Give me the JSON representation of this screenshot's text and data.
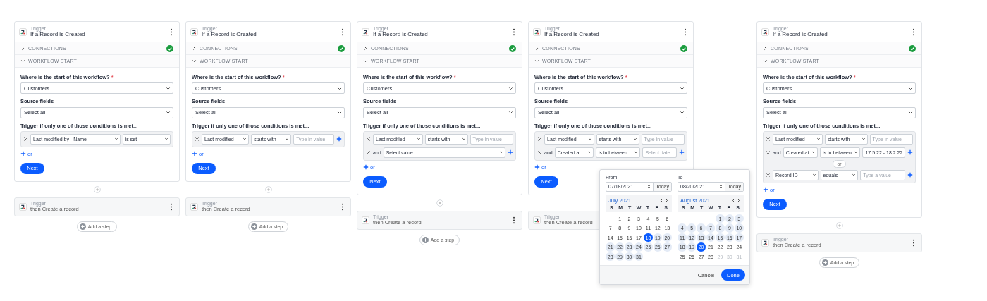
{
  "panels": [
    {
      "trigger_label": "Trigger",
      "title": "If a Record is Created",
      "connections": {
        "label": "CONNECTIONS",
        "expanded": false,
        "complete": true
      },
      "workflow_start": {
        "label": "WORKFLOW START",
        "expanded": true
      },
      "start_question": {
        "label": "Where is the start of this workflow?",
        "required_mark": "*",
        "value": "Customers"
      },
      "source_fields": {
        "label": "Source fields",
        "value": "Select all"
      },
      "conditions_label": "Trigger if only one of those conditions is met...",
      "condition_groups": [
        {
          "rows": [
            {
              "cells": [
                {
                  "kind": "select",
                  "value": "Last modified by - Name"
                },
                {
                  "kind": "select",
                  "value": "is set"
                }
              ],
              "add": false
            }
          ]
        }
      ],
      "add_or": "or",
      "next": "Next",
      "step": {
        "label": "Trigger",
        "title": "then Create a record"
      },
      "add_step": "Add a step"
    },
    {
      "trigger_label": "Trigger",
      "title": "If a Record is Created",
      "connections": {
        "label": "CONNECTIONS",
        "expanded": false,
        "complete": true
      },
      "workflow_start": {
        "label": "WORKFLOW START",
        "expanded": true
      },
      "start_question": {
        "label": "Where is the start of this workflow?",
        "required_mark": "*",
        "value": "Customers"
      },
      "source_fields": {
        "label": "Source fields",
        "value": "Select all"
      },
      "conditions_label": "Trigger if only one of those conditions is met...",
      "condition_groups": [
        {
          "rows": [
            {
              "cells": [
                {
                  "kind": "select",
                  "value": "Last modified"
                },
                {
                  "kind": "select",
                  "value": "starts with"
                },
                {
                  "kind": "input",
                  "placeholder": "Type in value"
                }
              ],
              "add": true
            }
          ]
        }
      ],
      "add_or": "or",
      "next": "Next",
      "step": {
        "label": "Trigger",
        "title": "then Create a record"
      },
      "add_step": "Add a step"
    },
    {
      "trigger_label": "Trigger",
      "title": "If a Record is Created",
      "connections": {
        "label": "CONNECTIONS",
        "expanded": false,
        "complete": true
      },
      "workflow_start": {
        "label": "WORKFLOW START",
        "expanded": true
      },
      "start_question": {
        "label": "Where is the start of this workflow?",
        "required_mark": "*",
        "value": "Customers"
      },
      "source_fields": {
        "label": "Source fields",
        "value": "Select all"
      },
      "conditions_label": "Trigger if only one of those conditions is met...",
      "condition_groups": [
        {
          "rows": [
            {
              "cells": [
                {
                  "kind": "select",
                  "value": "Last modified"
                },
                {
                  "kind": "select",
                  "value": "starts with"
                },
                {
                  "kind": "input",
                  "placeholder": "Type in value"
                }
              ],
              "add": false
            },
            {
              "conjunction": "and",
              "cells": [
                {
                  "kind": "select",
                  "value": "Select value"
                }
              ],
              "add": true
            }
          ]
        }
      ],
      "add_or": "or",
      "next": "Next",
      "step": {
        "label": "Trigger",
        "title": "then Create a record"
      },
      "add_step": "Add a step"
    },
    {
      "trigger_label": "Trigger",
      "title": "If a Record is Created",
      "connections": {
        "label": "CONNECTIONS",
        "expanded": false,
        "complete": true
      },
      "workflow_start": {
        "label": "WORKFLOW START",
        "expanded": true
      },
      "start_question": {
        "label": "Where is the start of this workflow?",
        "required_mark": "*",
        "value": "Customers"
      },
      "source_fields": {
        "label": "Source fields",
        "value": "Select all"
      },
      "conditions_label": "Trigger if only one of those conditions is met...",
      "condition_groups": [
        {
          "rows": [
            {
              "cells": [
                {
                  "kind": "select",
                  "value": "Last modified"
                },
                {
                  "kind": "select",
                  "value": "starts with"
                },
                {
                  "kind": "input",
                  "placeholder": "Type in value"
                }
              ],
              "add": false
            },
            {
              "conjunction": "and",
              "cells": [
                {
                  "kind": "select",
                  "value": "Created at"
                },
                {
                  "kind": "select",
                  "value": "is in between"
                },
                {
                  "kind": "input",
                  "placeholder": "Select date"
                }
              ],
              "add": true
            }
          ]
        }
      ],
      "add_or": "or",
      "next": "Next",
      "step": {
        "label": "Trigger",
        "title": "then Create a record"
      },
      "date_picker": {
        "fields": [
          {
            "label": "From",
            "value": "07/18/2021",
            "today": "Today"
          },
          {
            "label": "To",
            "value": "08/20/2021",
            "today": "Today"
          }
        ],
        "calendars": [
          {
            "month": "July 2021",
            "weekdays": [
              "S",
              "M",
              "T",
              "W",
              "T",
              "F",
              "S"
            ],
            "days": [
              {
                "kind": "blank"
              },
              {
                "kind": "day",
                "day": "1",
                "selected": false,
                "in_range": false,
                "disabled": false
              },
              {
                "kind": "day",
                "day": "2",
                "selected": false,
                "in_range": false,
                "disabled": false
              },
              {
                "kind": "day",
                "day": "3",
                "selected": false,
                "in_range": false,
                "disabled": false
              },
              {
                "kind": "day",
                "day": "4",
                "selected": false,
                "in_range": false,
                "disabled": false
              },
              {
                "kind": "day",
                "day": "5",
                "selected": false,
                "in_range": false,
                "disabled": false
              },
              {
                "kind": "day",
                "day": "6",
                "selected": false,
                "in_range": false,
                "disabled": false
              },
              {
                "kind": "day",
                "day": "7",
                "selected": false,
                "in_range": false,
                "disabled": false
              },
              {
                "kind": "day",
                "day": "8",
                "selected": false,
                "in_range": false,
                "disabled": false
              },
              {
                "kind": "day",
                "day": "9",
                "selected": false,
                "in_range": false,
                "disabled": false
              },
              {
                "kind": "day",
                "day": "10",
                "selected": false,
                "in_range": false,
                "disabled": false
              },
              {
                "kind": "day",
                "day": "11",
                "selected": false,
                "in_range": false,
                "disabled": false
              },
              {
                "kind": "day",
                "day": "12",
                "selected": false,
                "in_range": false,
                "disabled": false
              },
              {
                "kind": "day",
                "day": "13",
                "selected": false,
                "in_range": false,
                "disabled": false
              },
              {
                "kind": "day",
                "day": "14",
                "selected": false,
                "in_range": false,
                "disabled": false
              },
              {
                "kind": "day",
                "day": "15",
                "selected": false,
                "in_range": false,
                "disabled": false
              },
              {
                "kind": "day",
                "day": "16",
                "selected": false,
                "in_range": false,
                "disabled": false
              },
              {
                "kind": "day",
                "day": "17",
                "selected": false,
                "in_range": false,
                "disabled": false
              },
              {
                "kind": "day",
                "day": "18",
                "selected": true,
                "in_range": false,
                "disabled": false
              },
              {
                "kind": "day",
                "day": "19",
                "selected": false,
                "in_range": true,
                "disabled": false
              },
              {
                "kind": "day",
                "day": "20",
                "selected": false,
                "in_range": true,
                "disabled": false
              },
              {
                "kind": "day",
                "day": "21",
                "selected": false,
                "in_range": true,
                "disabled": false
              },
              {
                "kind": "day",
                "day": "22",
                "selected": false,
                "in_range": true,
                "disabled": false
              },
              {
                "kind": "day",
                "day": "23",
                "selected": false,
                "in_range": true,
                "disabled": false
              },
              {
                "kind": "day",
                "day": "24",
                "selected": false,
                "in_range": true,
                "disabled": false
              },
              {
                "kind": "day",
                "day": "25",
                "selected": false,
                "in_range": true,
                "disabled": false
              },
              {
                "kind": "day",
                "day": "26",
                "selected": false,
                "in_range": true,
                "disabled": false
              },
              {
                "kind": "day",
                "day": "27",
                "selected": false,
                "in_range": true,
                "disabled": false
              },
              {
                "kind": "day",
                "day": "28",
                "selected": false,
                "in_range": true,
                "disabled": false
              },
              {
                "kind": "day",
                "day": "29",
                "selected": false,
                "in_range": true,
                "disabled": false
              },
              {
                "kind": "day",
                "day": "30",
                "selected": false,
                "in_range": true,
                "disabled": false
              },
              {
                "kind": "day",
                "day": "31",
                "selected": false,
                "in_range": true,
                "disabled": false
              }
            ]
          },
          {
            "month": "August 2021",
            "weekdays": [
              "S",
              "M",
              "T",
              "W",
              "T",
              "F",
              "S"
            ],
            "days": [
              {
                "kind": "blank"
              },
              {
                "kind": "blank"
              },
              {
                "kind": "blank"
              },
              {
                "kind": "blank"
              },
              {
                "kind": "day",
                "day": "1",
                "selected": false,
                "in_range": true,
                "disabled": false
              },
              {
                "kind": "day",
                "day": "2",
                "selected": false,
                "in_range": true,
                "disabled": false
              },
              {
                "kind": "day",
                "day": "3",
                "selected": false,
                "in_range": true,
                "disabled": false
              },
              {
                "kind": "day",
                "day": "4",
                "selected": false,
                "in_range": true,
                "disabled": false
              },
              {
                "kind": "day",
                "day": "5",
                "selected": false,
                "in_range": true,
                "disabled": false
              },
              {
                "kind": "day",
                "day": "6",
                "selected": false,
                "in_range": true,
                "disabled": false
              },
              {
                "kind": "day",
                "day": "7",
                "selected": false,
                "in_range": true,
                "disabled": false
              },
              {
                "kind": "day",
                "day": "8",
                "selected": false,
                "in_range": true,
                "disabled": false
              },
              {
                "kind": "day",
                "day": "9",
                "selected": false,
                "in_range": true,
                "disabled": false
              },
              {
                "kind": "day",
                "day": "10",
                "selected": false,
                "in_range": true,
                "disabled": false
              },
              {
                "kind": "day",
                "day": "11",
                "selected": false,
                "in_range": true,
                "disabled": false
              },
              {
                "kind": "day",
                "day": "12",
                "selected": false,
                "in_range": true,
                "disabled": false
              },
              {
                "kind": "day",
                "day": "13",
                "selected": false,
                "in_range": true,
                "disabled": false
              },
              {
                "kind": "day",
                "day": "14",
                "selected": false,
                "in_range": true,
                "disabled": false
              },
              {
                "kind": "day",
                "day": "15",
                "selected": false,
                "in_range": true,
                "disabled": false
              },
              {
                "kind": "day",
                "day": "16",
                "selected": false,
                "in_range": true,
                "disabled": false
              },
              {
                "kind": "day",
                "day": "17",
                "selected": false,
                "in_range": true,
                "disabled": false
              },
              {
                "kind": "day",
                "day": "18",
                "selected": false,
                "in_range": true,
                "disabled": false
              },
              {
                "kind": "day",
                "day": "19",
                "selected": false,
                "in_range": true,
                "disabled": false
              },
              {
                "kind": "day",
                "day": "20",
                "selected": true,
                "in_range": false,
                "disabled": false
              },
              {
                "kind": "day",
                "day": "21",
                "selected": false,
                "in_range": false,
                "disabled": false
              },
              {
                "kind": "day",
                "day": "22",
                "selected": false,
                "in_range": false,
                "disabled": false
              },
              {
                "kind": "day",
                "day": "23",
                "selected": false,
                "in_range": false,
                "disabled": false
              },
              {
                "kind": "day",
                "day": "24",
                "selected": false,
                "in_range": false,
                "disabled": false
              },
              {
                "kind": "day",
                "day": "25",
                "selected": false,
                "in_range": false,
                "disabled": false
              },
              {
                "kind": "day",
                "day": "26",
                "selected": false,
                "in_range": false,
                "disabled": false
              },
              {
                "kind": "day",
                "day": "27",
                "selected": false,
                "in_range": false,
                "disabled": false
              },
              {
                "kind": "day",
                "day": "28",
                "selected": false,
                "in_range": false,
                "disabled": false
              },
              {
                "kind": "day",
                "day": "29",
                "selected": false,
                "in_range": false,
                "disabled": true
              },
              {
                "kind": "day",
                "day": "30",
                "selected": false,
                "in_range": false,
                "disabled": true
              },
              {
                "kind": "day",
                "day": "31",
                "selected": false,
                "in_range": false,
                "disabled": true
              }
            ]
          }
        ],
        "cancel": "Cancel",
        "done": "Done"
      }
    },
    {
      "trigger_label": "Trigger",
      "title": "If a Record is Created",
      "connections": {
        "label": "CONNECTIONS",
        "expanded": false,
        "complete": true
      },
      "workflow_start": {
        "label": "WORKFLOW START",
        "expanded": true
      },
      "start_question": {
        "label": "Where is the start of this workflow?",
        "required_mark": "*",
        "value": "Customers"
      },
      "source_fields": {
        "label": "Source fields",
        "value": "Select all"
      },
      "conditions_label": "Trigger if only one of those conditions is met...",
      "condition_groups": [
        {
          "rows": [
            {
              "cells": [
                {
                  "kind": "select",
                  "value": "Last modified"
                },
                {
                  "kind": "select",
                  "value": "starts with"
                },
                {
                  "kind": "input",
                  "placeholder": "Type in value"
                }
              ],
              "add": false
            },
            {
              "conjunction": "and",
              "cells": [
                {
                  "kind": "select",
                  "value": "Created at"
                },
                {
                  "kind": "select",
                  "value": "is in between"
                },
                {
                  "kind": "input",
                  "value": "17.5.22 - 18.2.22"
                }
              ],
              "add": true
            }
          ]
        },
        {
          "separator": "or",
          "rows": [
            {
              "cells": [
                {
                  "kind": "select",
                  "value": "Record ID"
                },
                {
                  "kind": "select",
                  "value": "equals"
                },
                {
                  "kind": "input",
                  "placeholder": "Type a value"
                }
              ],
              "add": true
            }
          ]
        }
      ],
      "add_or": "or",
      "next": "Next",
      "step": {
        "label": "Trigger",
        "title": "then Create a record"
      },
      "add_step": "Add a step"
    }
  ]
}
